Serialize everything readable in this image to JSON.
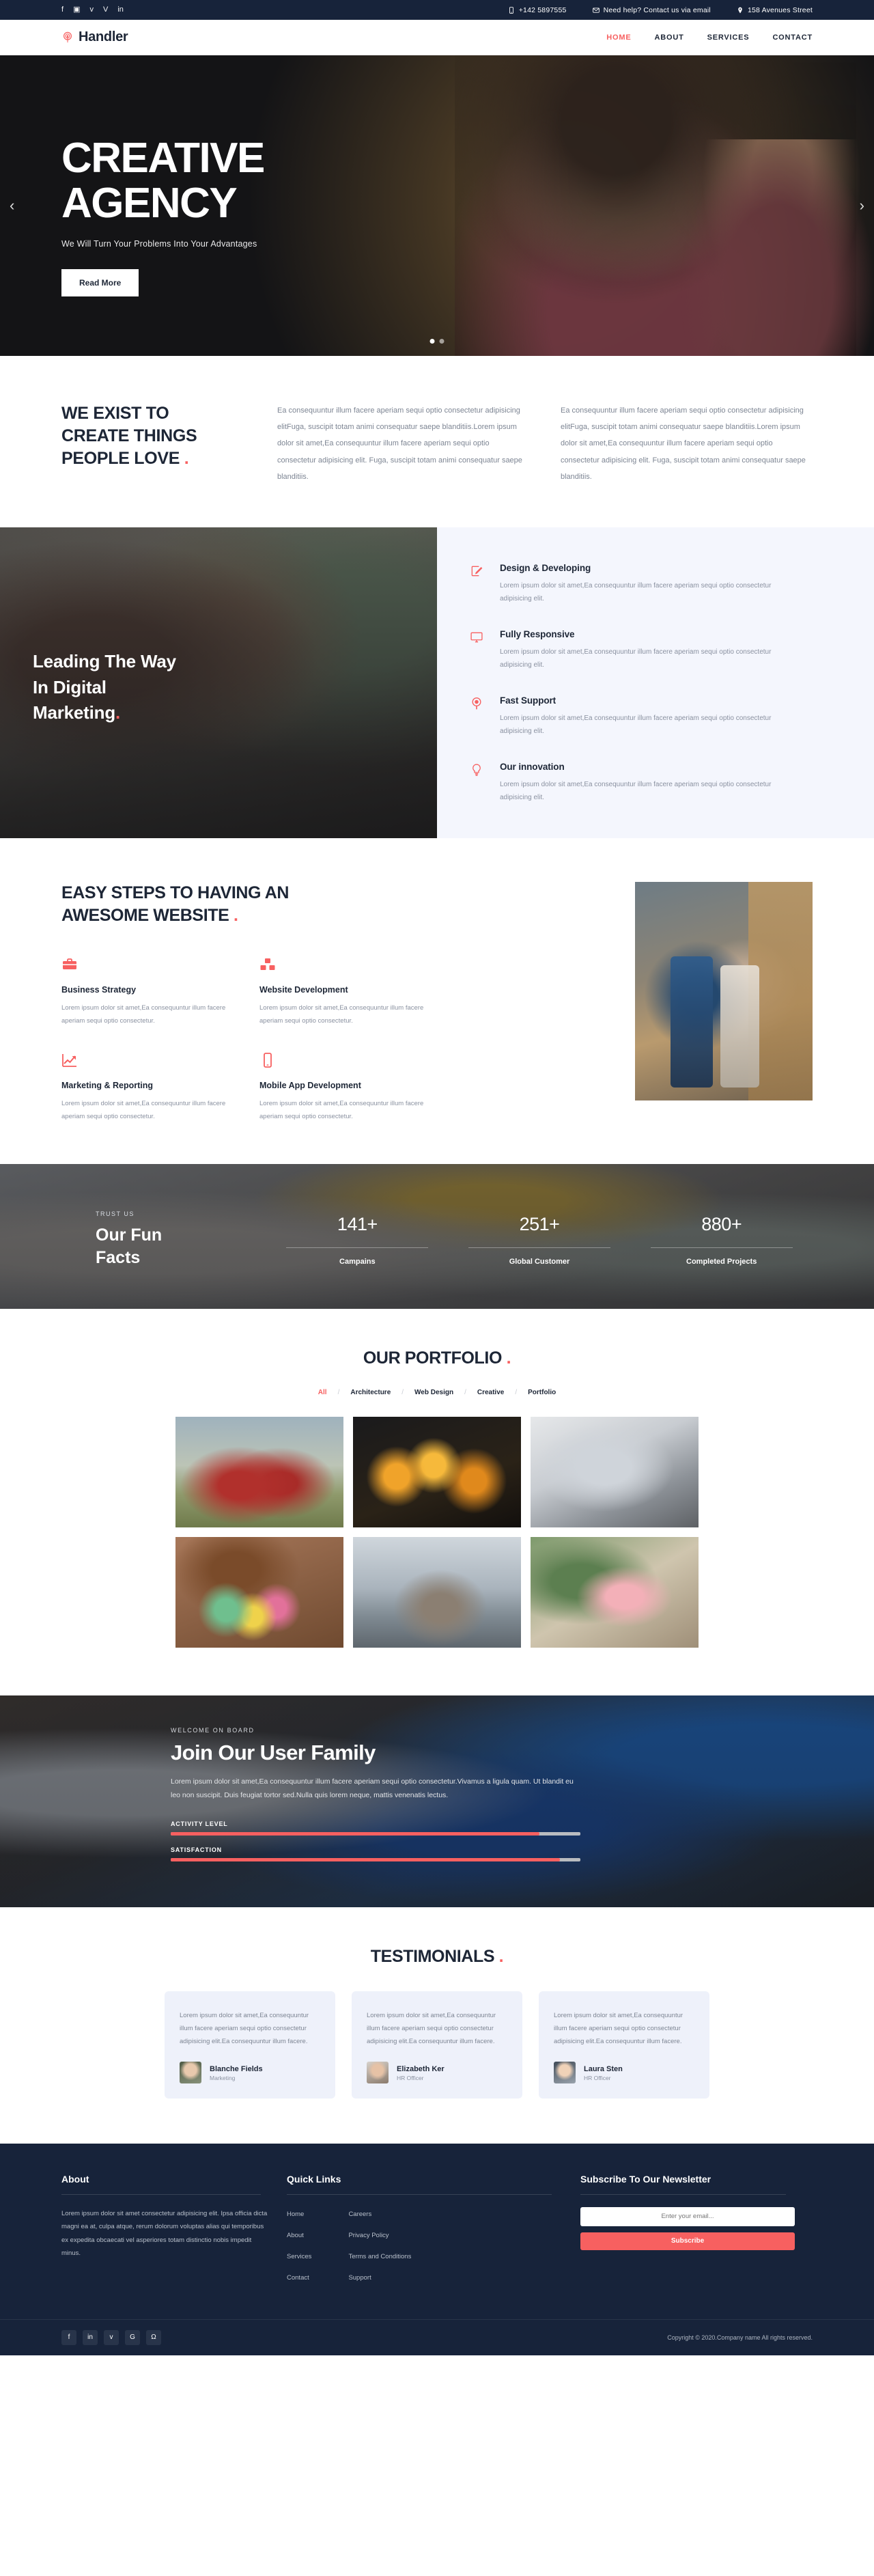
{
  "topbar": {
    "social": [
      {
        "name": "facebook-icon",
        "glyph": "f"
      },
      {
        "name": "instagram-icon",
        "glyph": "▣"
      },
      {
        "name": "twitter-icon",
        "glyph": "ᴠ"
      },
      {
        "name": "vimeo-icon",
        "glyph": "V"
      },
      {
        "name": "linkedin-icon",
        "glyph": "in"
      }
    ],
    "phone": "+142 5897555",
    "email": "Need help? Contact us via email",
    "address": "158 Avenues Street"
  },
  "header": {
    "logo_first": "H",
    "logo_rest": "andler",
    "nav": [
      {
        "label": "HOME",
        "active": true
      },
      {
        "label": "ABOUT",
        "active": false
      },
      {
        "label": "SERVICES",
        "active": false
      },
      {
        "label": "CONTACT",
        "active": false
      }
    ]
  },
  "hero": {
    "title_line1": "CREATIVE",
    "title_line2": "AGENCY",
    "subtitle": "We Will Turn Your Problems Into Your Advantages",
    "cta": "Read More",
    "prev": "‹",
    "next": "›"
  },
  "exist": {
    "heading_line1": "WE EXIST TO",
    "heading_line2": "CREATE THINGS",
    "heading_line3": "PEOPLE LOVE",
    "dot": ".",
    "paragraph1": "Ea consequuntur illum facere aperiam sequi optio consectetur adipisicing elitFuga, suscipit totam animi consequatur saepe blanditiis.Lorem ipsum dolor sit amet,Ea consequuntur illum facere aperiam sequi optio consectetur adipisicing elit. Fuga, suscipit totam animi consequatur saepe blanditiis.",
    "paragraph2": "Ea consequuntur illum facere aperiam sequi optio consectetur adipisicing elitFuga, suscipit totam animi consequatur saepe blanditiis.Lorem ipsum dolor sit amet,Ea consequuntur illum facere aperiam sequi optio consectetur adipisicing elit. Fuga, suscipit totam animi consequatur saepe blanditiis."
  },
  "leading": {
    "title_line1": "Leading The Way",
    "title_line2": "In Digital",
    "title_line3": "Marketing",
    "dot": ".",
    "services": [
      {
        "icon": "pencil-square-icon",
        "title": "Design & Developing",
        "text": "Lorem ipsum dolor sit amet,Ea consequuntur illum facere aperiam sequi optio consectetur adipisicing elit."
      },
      {
        "icon": "monitor-icon",
        "title": "Fully Responsive",
        "text": "Lorem ipsum dolor sit amet,Ea consequuntur illum facere aperiam sequi optio consectetur adipisicing elit."
      },
      {
        "icon": "support-target-icon",
        "title": "Fast Support",
        "text": "Lorem ipsum dolor sit amet,Ea consequuntur illum facere aperiam sequi optio consectetur adipisicing elit."
      },
      {
        "icon": "lightbulb-icon",
        "title": "Our innovation",
        "text": "Lorem ipsum dolor sit amet,Ea consequuntur illum facere aperiam sequi optio consectetur adipisicing elit."
      }
    ]
  },
  "steps": {
    "heading_line1": "EASY STEPS TO HAVING AN",
    "heading_line2": "AWESOME WEBSITE",
    "dot": ".",
    "cells": [
      {
        "icon": "briefcase-icon",
        "title": "Business Strategy",
        "text": "Lorem ipsum dolor sit amet,Ea consequuntur illum facere aperiam sequi optio consectetur."
      },
      {
        "icon": "boxes-icon",
        "title": "Website Development",
        "text": "Lorem ipsum dolor sit amet,Ea consequuntur illum facere aperiam sequi optio consectetur."
      },
      {
        "icon": "chart-arrow-icon",
        "title": "Marketing & Reporting",
        "text": "Lorem ipsum dolor sit amet,Ea consequuntur illum facere aperiam sequi optio consectetur."
      },
      {
        "icon": "mobile-phone-icon",
        "title": "Mobile App Development",
        "text": "Lorem ipsum dolor sit amet,Ea consequuntur illum facere aperiam sequi optio consectetur."
      }
    ]
  },
  "facts": {
    "kicker": "TRUST US",
    "title_line1": "Our Fun",
    "title_line2": "Facts",
    "counters": [
      {
        "value": "141+",
        "label": "Campains"
      },
      {
        "value": "251+",
        "label": "Global Customer"
      },
      {
        "value": "880+",
        "label": "Completed Projects"
      }
    ]
  },
  "portfolio": {
    "heading": "OUR PORTFOLIO",
    "dot": ".",
    "filters": [
      {
        "label": "All",
        "active": true
      },
      {
        "label": "Architecture",
        "active": false
      },
      {
        "label": "Web Design",
        "active": false
      },
      {
        "label": "Creative",
        "active": false
      },
      {
        "label": "Portfolio",
        "active": false
      }
    ],
    "separator": "/",
    "items": [
      {
        "name": "portfolio-item-red-chairs"
      },
      {
        "name": "portfolio-item-bokeh-glasses"
      },
      {
        "name": "portfolio-item-laptop-hands"
      },
      {
        "name": "portfolio-item-macarons-coffee"
      },
      {
        "name": "portfolio-item-pier-posts"
      },
      {
        "name": "portfolio-item-bottle-plant"
      }
    ]
  },
  "join": {
    "kicker": "WELCOME ON BOARD",
    "title": "Join Our User Family",
    "paragraph": "Lorem ipsum dolor sit amet,Ea consequuntur illum facere aperiam sequi optio consectetur.Vivamus a ligula quam. Ut blandit eu leo non suscipit. Duis feugiat tortor sed.Nulla quis lorem neque, mattis venenatis lectus.",
    "bars": [
      {
        "label": "ACTIVITY LEVEL",
        "percent": 90
      },
      {
        "label": "SATISFACTION",
        "percent": 95
      }
    ]
  },
  "testimonials": {
    "heading": "TESTIMONIALS",
    "dot": ".",
    "cards": [
      {
        "quote": "Lorem ipsum dolor sit amet,Ea consequuntur illum facere aperiam sequi optio consectetur adipisicing elit.Ea consequuntur illum facere.",
        "name": "Blanche Fields",
        "role": "Marketing"
      },
      {
        "quote": "Lorem ipsum dolor sit amet,Ea consequuntur illum facere aperiam sequi optio consectetur adipisicing elit.Ea consequuntur illum facere.",
        "name": "Elizabeth Ker",
        "role": "HR Officer"
      },
      {
        "quote": "Lorem ipsum dolor sit amet,Ea consequuntur illum facere aperiam sequi optio consectetur adipisicing elit.Ea consequuntur illum facere.",
        "name": "Laura Sten",
        "role": "HR Officer"
      }
    ]
  },
  "footer": {
    "about_title": "About",
    "about_text": "Lorem ipsum dolor sit amet consectetur adipisicing elit. Ipsa officia dicta magni ea at, culpa atque, rerum dolorum voluptas alias qui temporibus ex expedita obcaecati vel asperiores totam distinctio nobis impedit minus.",
    "links_title": "Quick Links",
    "links_col1": [
      "Home",
      "About",
      "Services",
      "Contact"
    ],
    "links_col2": [
      "Careers",
      "Privacy Policy",
      "Terms and Conditions",
      "Support"
    ],
    "news_title": "Subscribe To Our Newsletter",
    "news_placeholder": "Enter your email...",
    "news_button": "Subscribe",
    "socials": [
      {
        "name": "facebook-icon",
        "glyph": "f"
      },
      {
        "name": "linkedin-icon",
        "glyph": "in"
      },
      {
        "name": "twitter-icon",
        "glyph": "ᴠ"
      },
      {
        "name": "google-icon",
        "glyph": "G"
      },
      {
        "name": "github-icon",
        "glyph": "Ω"
      }
    ],
    "copyright": "Copyright © 2020.Company name All rights reserved."
  },
  "colors": {
    "accent": "#f76060",
    "dark": "#17233a",
    "muted": "#8a91a0",
    "panel": "#f4f6fd"
  }
}
